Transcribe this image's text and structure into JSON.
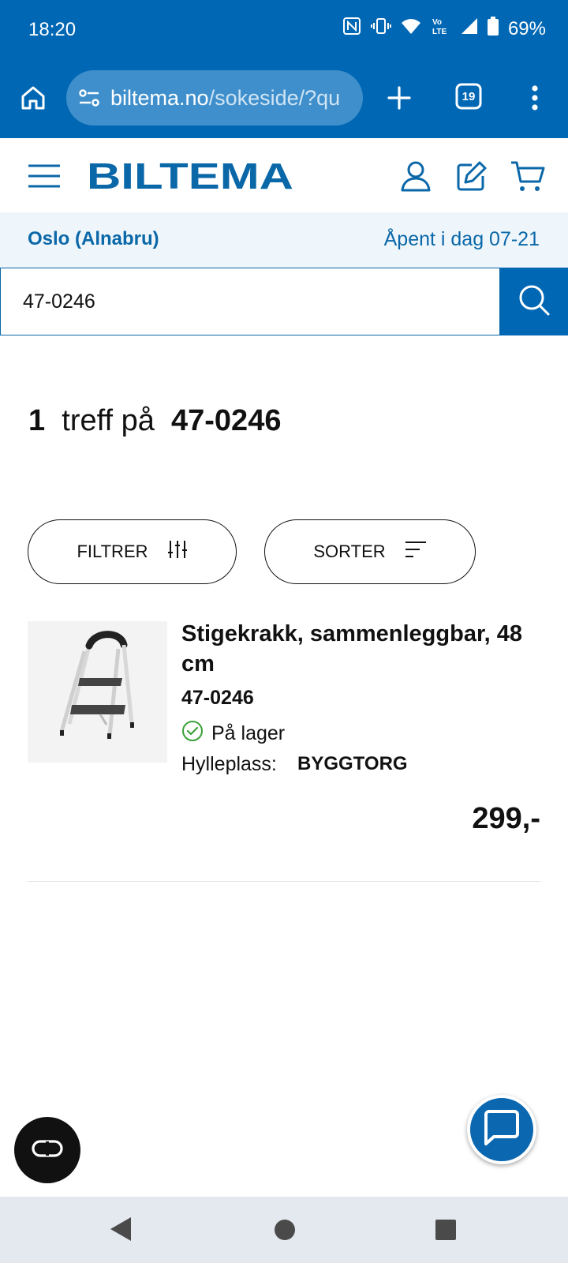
{
  "status_bar": {
    "time": "18:20",
    "battery": "69%",
    "icons": [
      "nfc-icon",
      "vibrate-icon",
      "wifi-icon",
      "volte-icon",
      "signal-icon",
      "battery-icon"
    ]
  },
  "browser": {
    "url_host": "biltema.no",
    "url_path": "/sokeside/?qu",
    "tab_count": "19"
  },
  "header": {
    "logo": "BILTEMA"
  },
  "store": {
    "name": "Oslo (Alnabru)",
    "hours": "Åpent i dag 07-21"
  },
  "search": {
    "value": "47-0246"
  },
  "results": {
    "count": "1",
    "middle": "treff på",
    "query": "47-0246"
  },
  "filters": {
    "filter_label": "FILTRER",
    "sort_label": "SORTER"
  },
  "product": {
    "title": "Stigekrakk, sammenleggbar, 48 cm",
    "sku": "47-0246",
    "stock": "På lager",
    "shelf_label": "Hylleplass:",
    "shelf_value": "BYGGTORG",
    "price": "299,-"
  },
  "colors": {
    "brand_blue": "#0067b4",
    "stock_green": "#3aa23a"
  }
}
